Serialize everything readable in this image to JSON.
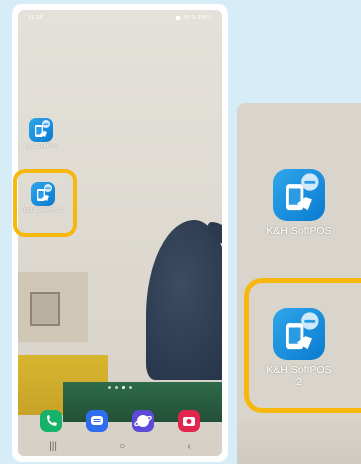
{
  "status_bar": {
    "time": "11:38",
    "right_text": "35 % 100%"
  },
  "home_screen": {
    "apps": [
      {
        "label": "K&H SoftPOS"
      },
      {
        "label": "K&H SoftPOS 2"
      }
    ],
    "dock": [
      "phone-icon",
      "messages-icon",
      "browser-icon",
      "camera-icon"
    ]
  },
  "zoom": {
    "apps": [
      {
        "label": "K&H SoftPOS"
      },
      {
        "label_line1": "K&H SoftPOS",
        "label_line2": "2"
      }
    ]
  },
  "nav_bar": {
    "recents": "|||",
    "home": "○",
    "back": "‹"
  },
  "colors": {
    "background": "#d6ecf6",
    "highlight": "#f6b70e",
    "app_icon": "#1590e0"
  }
}
